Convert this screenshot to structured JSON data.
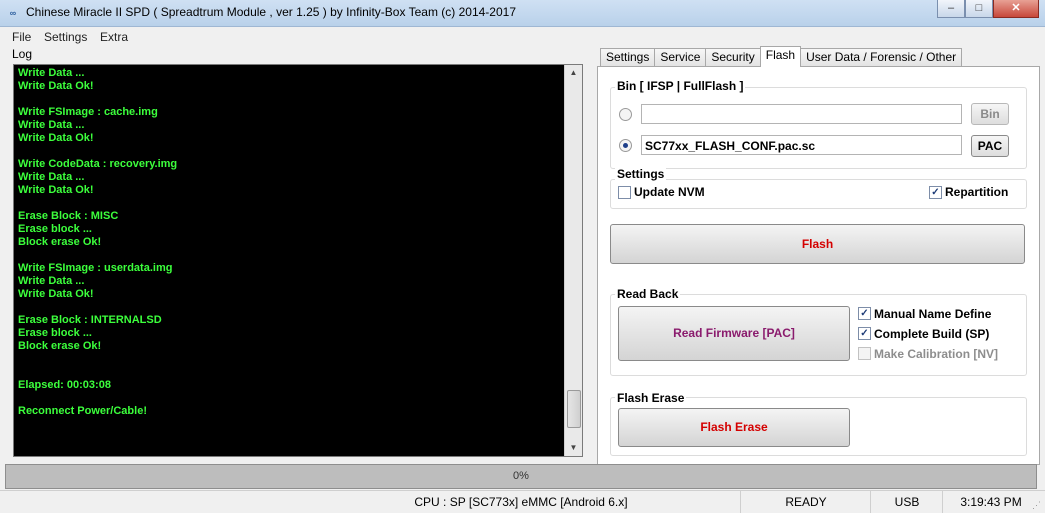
{
  "window": {
    "title": "Chinese Miracle II SPD ( Spreadtrum Module , ver 1.25 ) by Infinity-Box Team (c) 2014-2017",
    "icon_text": "∞",
    "minimize_glyph": "–",
    "maximize_glyph": "□",
    "close_glyph": "✕"
  },
  "menu": [
    "File",
    "Settings",
    "Extra"
  ],
  "log": {
    "label": "Log",
    "lines": [
      "Write Data ...",
      "Write Data Ok!",
      "",
      "Write FSImage : cache.img",
      "Write Data ...",
      "Write Data Ok!",
      "",
      "Write CodeData : recovery.img",
      "Write Data ...",
      "Write Data Ok!",
      "",
      "Erase Block : MISC",
      "Erase block ...",
      "Block erase Ok!",
      "",
      "Write FSImage : userdata.img",
      "Write Data ...",
      "Write Data Ok!",
      "",
      "Erase Block : INTERNALSD",
      "Erase block ...",
      "Block erase Ok!",
      "",
      "",
      "Elapsed: 00:03:08",
      "",
      "Reconnect Power/Cable!"
    ],
    "text_color": "#3cff3c",
    "background": "#000000"
  },
  "tabs": {
    "items": [
      "Settings",
      "Service",
      "Security",
      "Flash",
      "User Data / Forensic / Other"
    ],
    "active": "Flash"
  },
  "flash_tab": {
    "bin_group": {
      "label": "Bin  [ IFSP | FullFlash ]",
      "bin_path": "",
      "bin_button": "Bin",
      "pac_path": "SC77xx_FLASH_CONF.pac.sc",
      "pac_button": "PAC",
      "selected": "pac"
    },
    "settings_group": {
      "label": "Settings",
      "update_nvm": {
        "label": "Update NVM",
        "checked": false
      },
      "repartition": {
        "label": "Repartition",
        "checked": true
      }
    },
    "flash_button": "Flash",
    "read_back_group": {
      "label": "Read Back",
      "read_button": "Read Firmware [PAC]",
      "manual_name": {
        "label": "Manual Name Define",
        "checked": true
      },
      "complete_build": {
        "label": "Complete Build (SP)",
        "checked": true
      },
      "make_calibration": {
        "label": "Make Calibration [NV]",
        "checked": false,
        "disabled": true
      }
    },
    "flash_erase_group": {
      "label": "Flash Erase",
      "erase_button": "Flash Erase"
    }
  },
  "progress": {
    "value": 0,
    "text": "0%"
  },
  "status": {
    "cpu": "CPU : SP [SC773x] eMMC [Android 6.x]",
    "state": "READY",
    "connection": "USB",
    "time": "3:19:43 PM"
  },
  "colors": {
    "red_button_text": "#d40000",
    "purple_button_text": "#8a1b6d",
    "checkmark": "#1f3d78",
    "progress_fill": "#5cc04f"
  }
}
